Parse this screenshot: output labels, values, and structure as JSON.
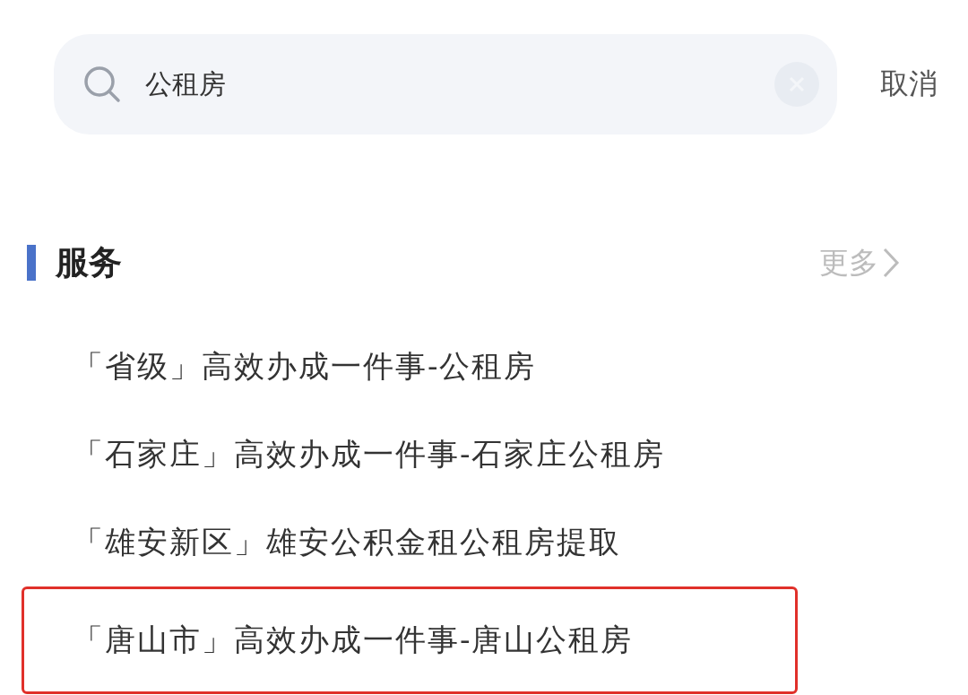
{
  "search": {
    "value": "公租房"
  },
  "cancel": "取消",
  "section": {
    "title": "服务",
    "more": "更多"
  },
  "items": [
    {
      "text": "「省级」高效办成一件事-公租房",
      "highlighted": false
    },
    {
      "text": "「石家庄」高效办成一件事-石家庄公租房",
      "highlighted": false
    },
    {
      "text": "「雄安新区」雄安公积金租公租房提取",
      "highlighted": false
    },
    {
      "text": "「唐山市」高效办成一件事-唐山公租房",
      "highlighted": true
    }
  ]
}
